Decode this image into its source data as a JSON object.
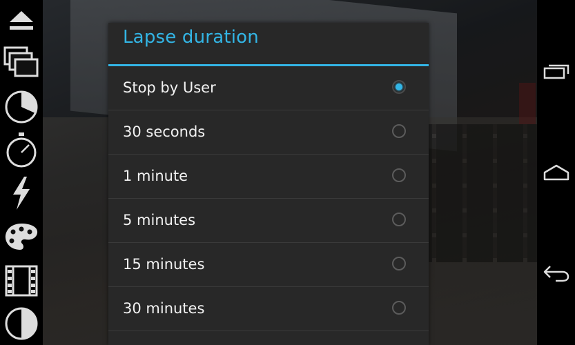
{
  "dialog": {
    "title": "Lapse duration",
    "options": [
      {
        "label": "Stop by User",
        "selected": true
      },
      {
        "label": "30 seconds",
        "selected": false
      },
      {
        "label": "1 minute",
        "selected": false
      },
      {
        "label": "5 minutes",
        "selected": false
      },
      {
        "label": "15 minutes",
        "selected": false
      },
      {
        "label": "30 minutes",
        "selected": false
      }
    ]
  },
  "toolbar": {
    "icons": [
      "eject-icon",
      "multi-window-icon",
      "pie-timer-icon",
      "stopwatch-icon",
      "flash-icon",
      "palette-icon",
      "film-icon",
      "contrast-icon"
    ]
  },
  "navigation": {
    "icons": [
      "recent-apps-icon",
      "home-icon",
      "back-icon"
    ]
  },
  "colors": {
    "accent": "#33b5e5",
    "dialog_bg": "#282828",
    "text": "#f2f2f2"
  }
}
